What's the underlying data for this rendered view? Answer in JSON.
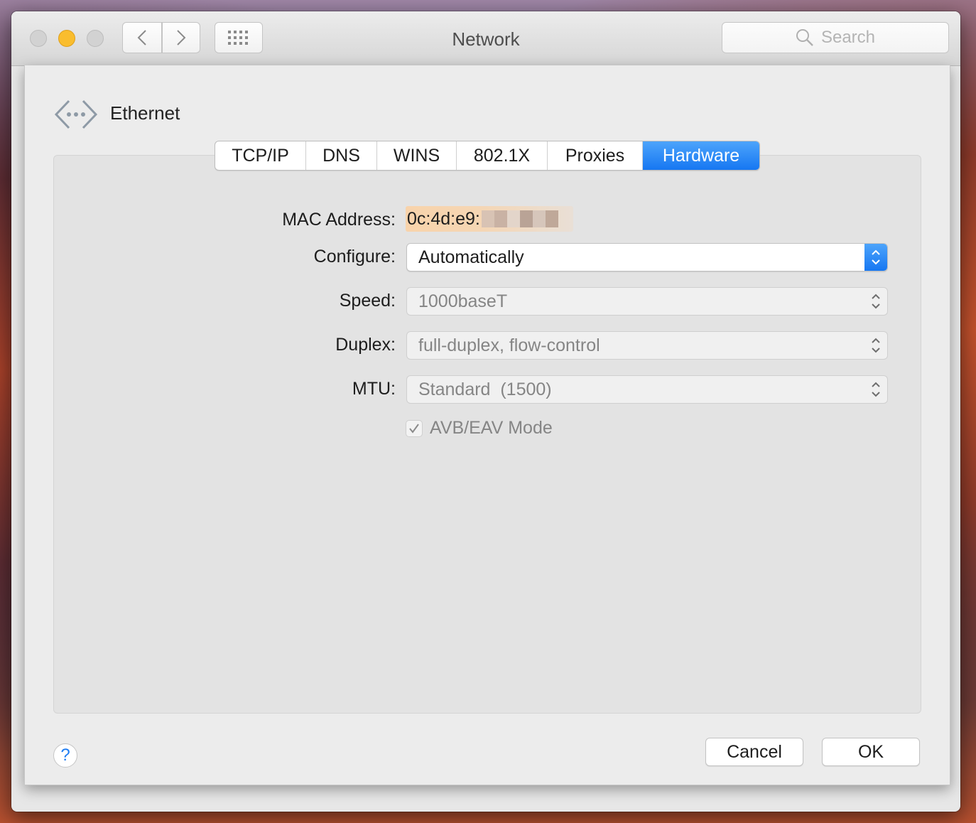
{
  "window": {
    "title": "Network"
  },
  "toolbar": {
    "search_placeholder": "Search",
    "icons": [
      "back-chevron-icon",
      "forward-chevron-icon",
      "grid-icon",
      "search-icon"
    ]
  },
  "interface": {
    "name": "Ethernet",
    "icon": "ethernet-icon"
  },
  "tabs": [
    {
      "label": "TCP/IP",
      "active": false
    },
    {
      "label": "DNS",
      "active": false
    },
    {
      "label": "WINS",
      "active": false
    },
    {
      "label": "802.1X",
      "active": false
    },
    {
      "label": "Proxies",
      "active": false
    },
    {
      "label": "Hardware",
      "active": true
    }
  ],
  "form": {
    "mac_label": "MAC Address:",
    "mac_value": "0c:4d:e9:",
    "configure_label": "Configure:",
    "configure_value": "Automatically",
    "speed_label": "Speed:",
    "speed_value": "1000baseT",
    "duplex_label": "Duplex:",
    "duplex_value": "full-duplex, flow-control",
    "mtu_label": "MTU:",
    "mtu_value": "Standard  (1500)",
    "avb_label": "AVB/EAV Mode",
    "avb_checked": true
  },
  "footer": {
    "help_label": "?",
    "cancel_label": "Cancel",
    "ok_label": "OK"
  },
  "colors": {
    "accent": "#1677f2",
    "traffic_minimize": "#f9bd2e",
    "mac_highlight": "#f8d3ab"
  }
}
